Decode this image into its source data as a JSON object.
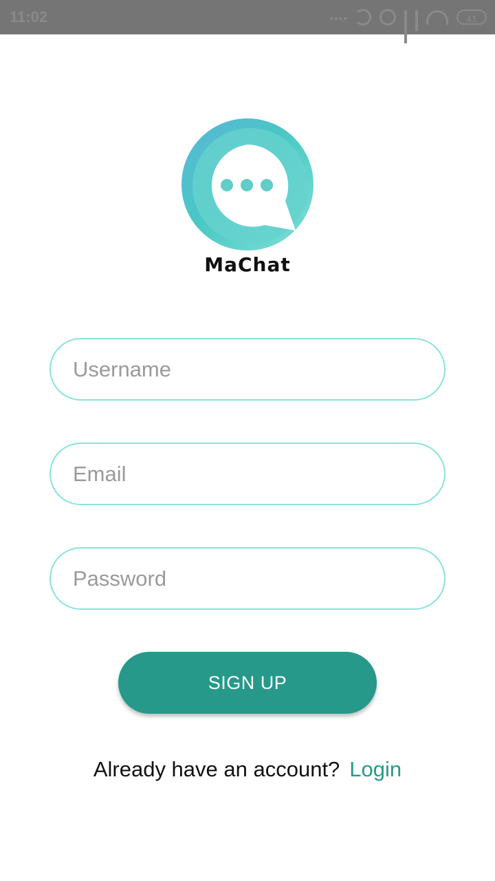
{
  "status_bar": {
    "time": "11:02",
    "battery": "41"
  },
  "app": {
    "name": "MaChat"
  },
  "form": {
    "username": {
      "placeholder": "Username",
      "value": ""
    },
    "email": {
      "placeholder": "Email",
      "value": ""
    },
    "password": {
      "placeholder": "Password",
      "value": ""
    },
    "signup_label": "SIGN UP"
  },
  "footer": {
    "prompt": "Already have an account?",
    "login_label": "Login"
  },
  "colors": {
    "accent": "#27998b",
    "field_border": "#86e3da",
    "logo": "#5fd0cb"
  },
  "icons": [
    "moon-icon",
    "alarm-icon",
    "signal-icon",
    "wifi-icon",
    "battery-icon",
    "chat-bubble-icon"
  ]
}
